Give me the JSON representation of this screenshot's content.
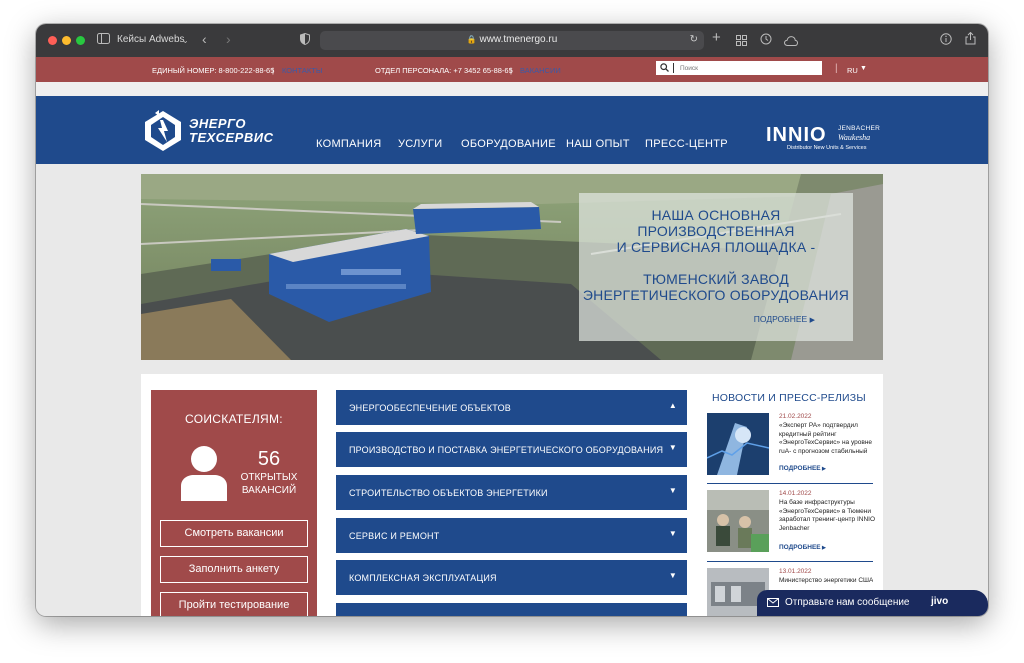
{
  "browser": {
    "sidebar_label": "Кейсы Adwebs",
    "url": "www.tmenergo.ru"
  },
  "topbar": {
    "phone_label": "ЕДИНЫЙ НОМЕР: 8-800-222-88-65",
    "contacts_link": "КОНТАКТЫ",
    "staff_label": "ОТДЕЛ ПЕРСОНАЛА: +7 3452 65-88-65",
    "vacancies_link": "ВАКАНСИИ",
    "search_placeholder": "Поиск",
    "language": "RU"
  },
  "header": {
    "logo_line1": "ЭНЕРГО",
    "logo_line2": "ТЕХСЕРВИС",
    "nav": [
      "КОМПАНИЯ",
      "УСЛУГИ",
      "ОБОРУДОВАНИЕ",
      "НАШ ОПЫТ",
      "ПРЕСС-ЦЕНТР"
    ],
    "partner_logo": "INNIO",
    "partner_sub1": "JENBACHER",
    "partner_sub2": "Waukesha",
    "partner_tagline": "Distributor New Units & Services"
  },
  "hero": {
    "lines": [
      "НАША ОСНОВНАЯ",
      "ПРОИЗВОДСТВЕННАЯ",
      "И СЕРВИСНАЯ ПЛОЩАДКА -",
      "",
      "ТЮМЕНСКИЙ ЗАВОД",
      "ЭНЕРГЕТИЧЕСКОГО ОБОРУДОВАНИЯ"
    ],
    "more": "ПОДРОБНЕЕ"
  },
  "jobs": {
    "title": "СОИСКАТЕЛЯМ:",
    "count": "56",
    "count_label1": "ОТКРЫТЫХ",
    "count_label2": "ВАКАНСИЙ",
    "buttons": [
      "Смотреть вакансии",
      "Заполнить анкету",
      "Пройти тестирование"
    ]
  },
  "services": [
    {
      "label": "ЭНЕРГООБЕСПЕЧЕНИЕ ОБЪЕКТОВ",
      "arrow": "▲"
    },
    {
      "label": "ПРОИЗВОДСТВО И ПОСТАВКА ЭНЕРГЕТИЧЕСКОГО ОБОРУДОВАНИЯ",
      "arrow": "▼"
    },
    {
      "label": "СТРОИТЕЛЬСТВО ОБЪЕКТОВ ЭНЕРГЕТИКИ",
      "arrow": "▼"
    },
    {
      "label": "СЕРВИС И РЕМОНТ",
      "arrow": "▼"
    },
    {
      "label": "КОМПЛЕКСНАЯ ЭКСПЛУАТАЦИЯ",
      "arrow": "▼"
    }
  ],
  "news": {
    "title": "НОВОСТИ И ПРЕСС-РЕЛИЗЫ",
    "more": "ПОДРОБНЕЕ",
    "items": [
      {
        "date": "21.02.2022",
        "text": "«Эксперт РА» подтвердил кредитный рейтинг «ЭнергоТехСервис» на уровне ruA- с прогнозом стабильный"
      },
      {
        "date": "14.01.2022",
        "text": "На базе инфраструктуры «ЭнергоТехСервис» в Тюмени заработал тренинг-центр INNIO Jenbacher"
      },
      {
        "date": "13.01.2022",
        "text": "Министерство энергетики США"
      }
    ]
  },
  "chat": {
    "label": "Отправьте нам сообщение",
    "brand": "jivo"
  },
  "colors": {
    "brand_blue": "#1f4a8c",
    "brand_red": "#a04a4a"
  }
}
